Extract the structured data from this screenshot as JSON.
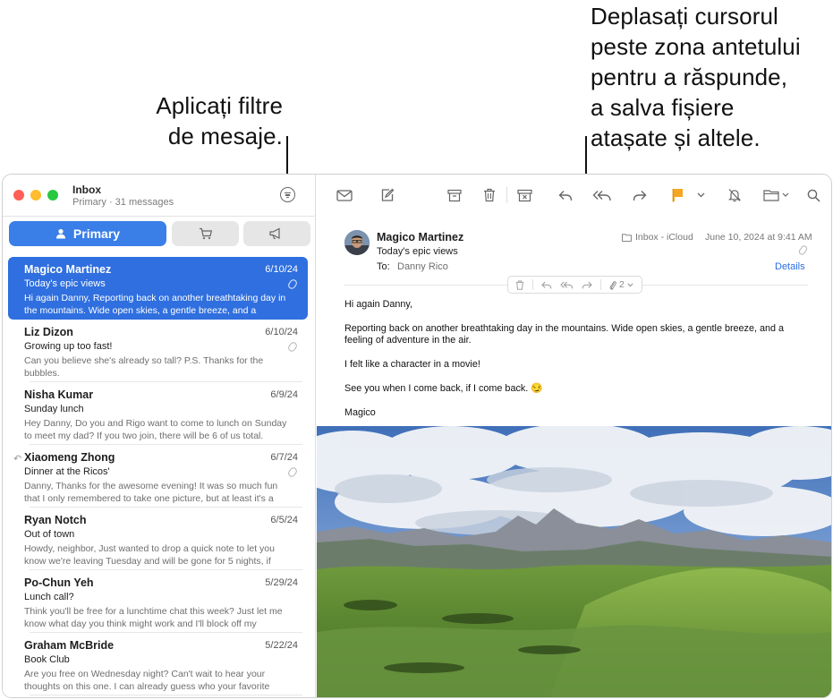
{
  "callouts": {
    "filters": [
      "Aplicați filtre",
      "de mesaje."
    ],
    "header": [
      "Deplasați cursorul",
      "peste zona antetului",
      "pentru a răspunde,",
      "a salva fișiere",
      "atașate și altele."
    ]
  },
  "sidebar": {
    "title": "Inbox",
    "subtitle": "Primary · 31 messages",
    "filter_icon": "filter-icon",
    "tabs": {
      "primary_label": "Primary",
      "primary_icon": "person-icon",
      "others": [
        "cart-icon",
        "chat-bubble-icon",
        "megaphone-icon"
      ]
    }
  },
  "messages": [
    {
      "sender": "Magico Martinez",
      "date": "6/10/24",
      "subject": "Today's epic views",
      "preview": "Hi again Danny, Reporting back on another breathtaking day in the mountains. Wide open skies, a gentle breeze, and a feeling…",
      "attachment": true,
      "replied": false,
      "selected": true
    },
    {
      "sender": "Liz Dizon",
      "date": "6/10/24",
      "subject": "Growing up too fast!",
      "preview": "Can you believe she's already so tall? P.S. Thanks for the bubbles.",
      "attachment": true,
      "replied": false,
      "selected": false
    },
    {
      "sender": "Nisha Kumar",
      "date": "6/9/24",
      "subject": "Sunday lunch",
      "preview": "Hey Danny, Do you and Rigo want to come to lunch on Sunday to meet my dad? If you two join, there will be 6 of us total. Would…",
      "attachment": false,
      "replied": false,
      "selected": false
    },
    {
      "sender": "Xiaomeng Zhong",
      "date": "6/7/24",
      "subject": "Dinner at the Ricos'",
      "preview": "Danny, Thanks for the awesome evening! It was so much fun that I only remembered to take one picture, but at least it's a good…",
      "attachment": true,
      "replied": true,
      "selected": false
    },
    {
      "sender": "Ryan Notch",
      "date": "6/5/24",
      "subject": "Out of town",
      "preview": "Howdy, neighbor, Just wanted to drop a quick note to let you know we're leaving Tuesday and will be gone for 5 nights, if yo…",
      "attachment": false,
      "replied": false,
      "selected": false
    },
    {
      "sender": "Po-Chun Yeh",
      "date": "5/29/24",
      "subject": "Lunch call?",
      "preview": "Think you'll be free for a lunchtime chat this week? Just let me know what day you think might work and I'll block off my sched…",
      "attachment": false,
      "replied": false,
      "selected": false
    },
    {
      "sender": "Graham McBride",
      "date": "5/22/24",
      "subject": "Book Club",
      "preview": "Are you free on Wednesday night? Can't wait to hear your thoughts on this one. I can already guess who your favorite cha…",
      "attachment": false,
      "replied": false,
      "selected": false
    }
  ],
  "toolbar": {
    "icons": [
      "envelope-icon",
      "compose-icon",
      "archive-icon",
      "trash-icon",
      "junk-icon",
      "reply-icon",
      "reply-all-icon",
      "forward-icon",
      "flag-icon",
      "mute-icon",
      "move-to-folder-icon",
      "search-icon"
    ]
  },
  "reader": {
    "from": "Magico Martinez",
    "subject": "Today's epic views",
    "to_label": "To:",
    "to_value": "Danny Rico",
    "mailbox": "Inbox - iCloud",
    "datetime": "June 10, 2024 at 9:41 AM",
    "details_label": "Details",
    "hover_bar": {
      "attachment_count": "2"
    },
    "body": [
      "Hi again Danny,",
      "Reporting back on another breathtaking day in the mountains. Wide open skies, a gentle breeze, and a feeling of adventure in the air.",
      "I felt like a character in a movie!",
      "See you when I come back, if I come back. 😏",
      "Magico"
    ]
  },
  "colors": {
    "accent": "#2f6fdf",
    "flag": "#f5a623",
    "link": "#2a6de0"
  }
}
